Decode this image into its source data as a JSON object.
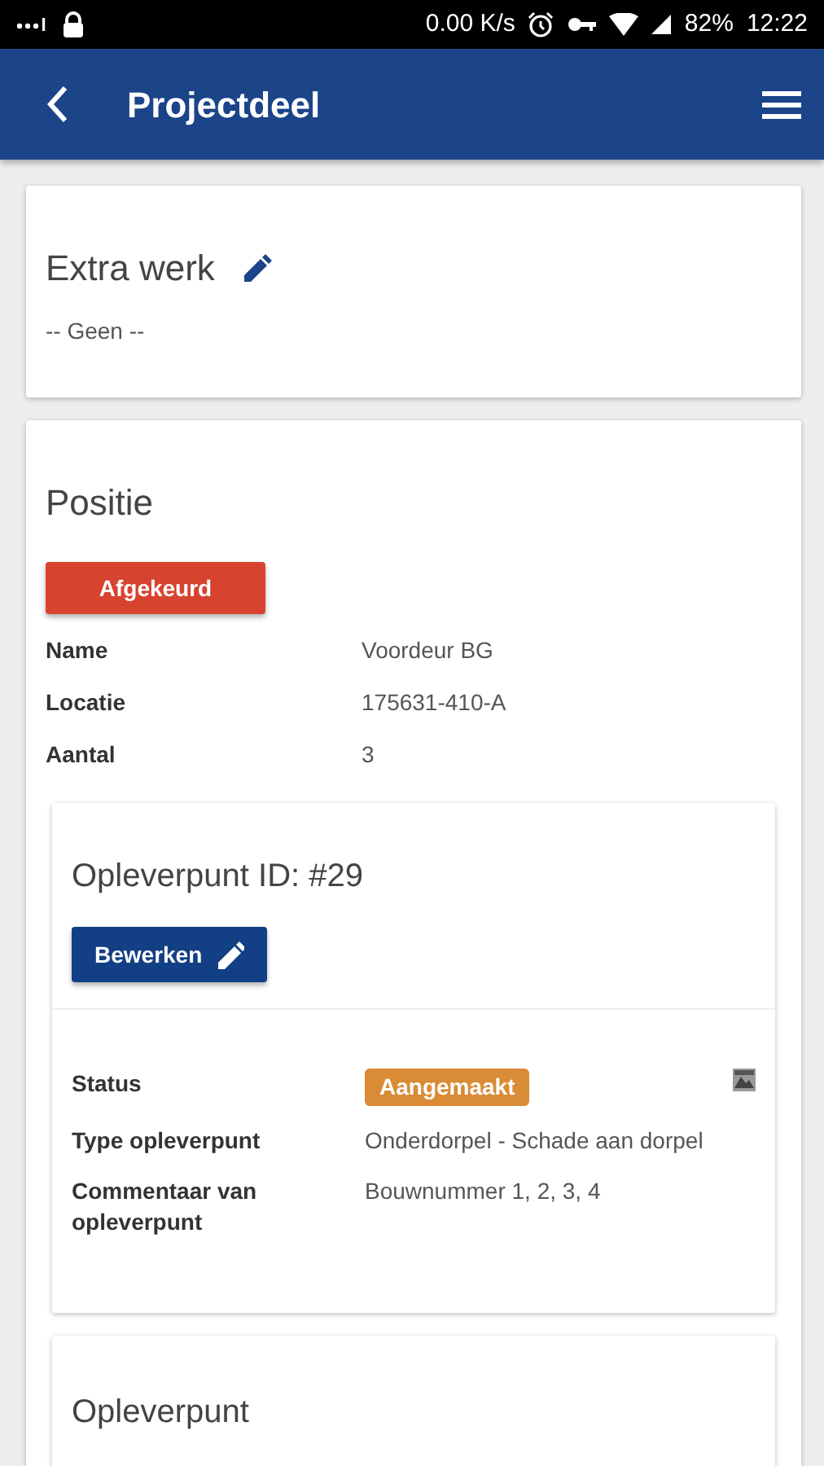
{
  "status_bar": {
    "speed": "0.00 K/s",
    "battery": "82%",
    "time": "12:22"
  },
  "app_bar": {
    "title": "Projectdeel"
  },
  "extra_werk": {
    "title": "Extra werk",
    "value": "-- Geen --"
  },
  "positie": {
    "title": "Positie",
    "status_button": "Afgekeurd",
    "fields": [
      {
        "label": "Name",
        "value": "Voordeur BG"
      },
      {
        "label": "Locatie",
        "value": "175631-410-A"
      },
      {
        "label": "Aantal",
        "value": "3"
      }
    ]
  },
  "opleverpunten": [
    {
      "title": "Opleverpunt ID: #29",
      "edit_button": "Bewerken",
      "fields": [
        {
          "kind": "badge",
          "label": "Status",
          "value": "Aangemaakt"
        },
        {
          "kind": "text",
          "label": "Type opleverpunt",
          "value": "Onderdorpel - Schade aan dorpel"
        },
        {
          "kind": "text",
          "label": "Commentaar van opleverpunt",
          "value": "Bouwnummer 1, 2, 3, 4"
        }
      ]
    },
    {
      "title": "Opleverpunt"
    }
  ]
}
